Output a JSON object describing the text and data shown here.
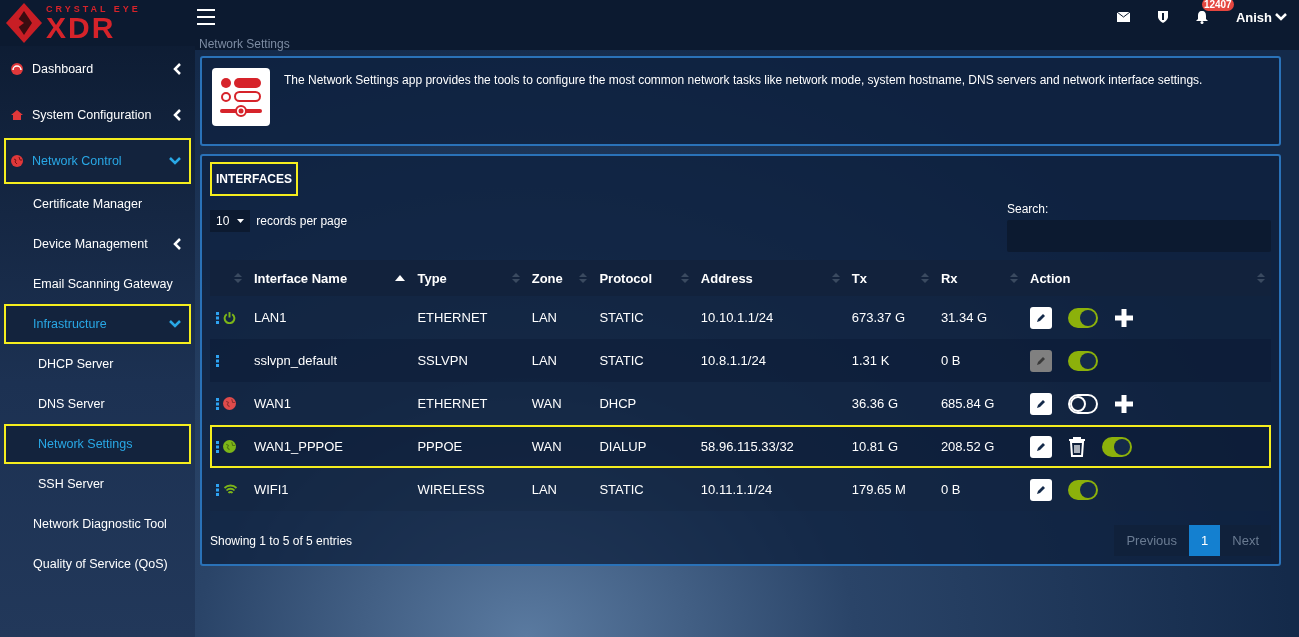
{
  "brand": {
    "tagline": "CRYSTAL EYE",
    "name": "XDR"
  },
  "header": {
    "page_title": "Network Settings",
    "notification_count": "12407",
    "user": "Anish"
  },
  "sidebar": {
    "items": [
      {
        "label": "Dashboard",
        "expanded": false,
        "selected": false,
        "highlighted": false
      },
      {
        "label": "System Configuration",
        "expanded": false,
        "selected": false,
        "highlighted": false
      },
      {
        "label": "Network Control",
        "expanded": true,
        "selected": true,
        "highlighted": true,
        "children": [
          {
            "label": "Certificate Manager",
            "selected": false,
            "highlighted": false
          },
          {
            "label": "Device Management",
            "expanded": false,
            "selected": false,
            "highlighted": false
          },
          {
            "label": "Email Scanning Gateway",
            "selected": false,
            "highlighted": false
          },
          {
            "label": "Infrastructure",
            "expanded": true,
            "selected": true,
            "highlighted": true,
            "children": [
              {
                "label": "DHCP Server",
                "selected": false,
                "highlighted": false
              },
              {
                "label": "DNS Server",
                "selected": false,
                "highlighted": false
              },
              {
                "label": "Network Settings",
                "selected": true,
                "highlighted": true
              },
              {
                "label": "SSH Server",
                "selected": false,
                "highlighted": false
              }
            ]
          },
          {
            "label": "Network Diagnostic Tool",
            "selected": false,
            "highlighted": false
          },
          {
            "label": "Quality of Service (QoS)",
            "selected": false,
            "highlighted": false
          }
        ]
      }
    ]
  },
  "intro": {
    "text": "The Network Settings app provides the tools to configure the most common network tasks like network mode, system hostname, DNS servers and network interface settings."
  },
  "interfaces": {
    "title": "INTERFACES",
    "title_highlighted": true,
    "page_size": "10",
    "page_size_label": "records per page",
    "search_label": "Search:",
    "columns": [
      {
        "sorted": false
      },
      {
        "label": "Interface Name",
        "sorted": true
      },
      {
        "label": "Type",
        "sorted": false
      },
      {
        "label": "Zone",
        "sorted": false
      },
      {
        "label": "Protocol",
        "sorted": false
      },
      {
        "label": "Address",
        "sorted": false
      },
      {
        "label": "Tx",
        "sorted": false
      },
      {
        "label": "Rx",
        "sorted": false
      },
      {
        "label": "Action",
        "sorted": false
      }
    ],
    "rows": [
      {
        "status": {
          "kind": "power",
          "color": "#7cb518"
        },
        "name": "LAN1",
        "type": "ETHERNET",
        "zone": "LAN",
        "protocol": "STATIC",
        "address": "10.10.1.1/24",
        "tx": "673.37 G",
        "rx": "31.34 G",
        "edit_enabled": true,
        "on": true,
        "add": true,
        "delete": false,
        "highlighted": false
      },
      {
        "name": "sslvpn_default",
        "type": "SSLVPN",
        "zone": "LAN",
        "protocol": "STATIC",
        "address": "10.8.1.1/24",
        "tx": "1.31 K",
        "rx": "0 B",
        "edit_enabled": false,
        "on": true,
        "add": false,
        "delete": false,
        "highlighted": false
      },
      {
        "status": {
          "kind": "globe",
          "color": "#e04b4b"
        },
        "name": "WAN1",
        "type": "ETHERNET",
        "zone": "WAN",
        "protocol": "DHCP",
        "tx": "36.36 G",
        "rx": "685.84 G",
        "edit_enabled": true,
        "on": false,
        "add": true,
        "delete": false,
        "highlighted": false
      },
      {
        "status": {
          "kind": "globe",
          "color": "#7cb518"
        },
        "name": "WAN1_PPPOE",
        "type": "PPPOE",
        "zone": "WAN",
        "protocol": "DIALUP",
        "address": "58.96.115.33/32",
        "tx": "10.81 G",
        "rx": "208.52 G",
        "edit_enabled": true,
        "on": true,
        "add": false,
        "delete": true,
        "highlighted": true
      },
      {
        "status": {
          "kind": "wifi",
          "color": "#7cb518"
        },
        "name": "WIFI1",
        "type": "WIRELESS",
        "zone": "LAN",
        "protocol": "STATIC",
        "address": "10.11.1.1/24",
        "tx": "179.65 M",
        "rx": "0 B",
        "edit_enabled": true,
        "on": true,
        "add": false,
        "delete": false,
        "highlighted": false
      }
    ],
    "summary": "Showing 1 to 5 of 5 entries",
    "pagination": [
      {
        "label": "Previous",
        "disabled": true,
        "selected": false
      },
      {
        "label": "1",
        "disabled": false,
        "selected": true
      },
      {
        "label": "Next",
        "disabled": true,
        "selected": false
      }
    ]
  }
}
